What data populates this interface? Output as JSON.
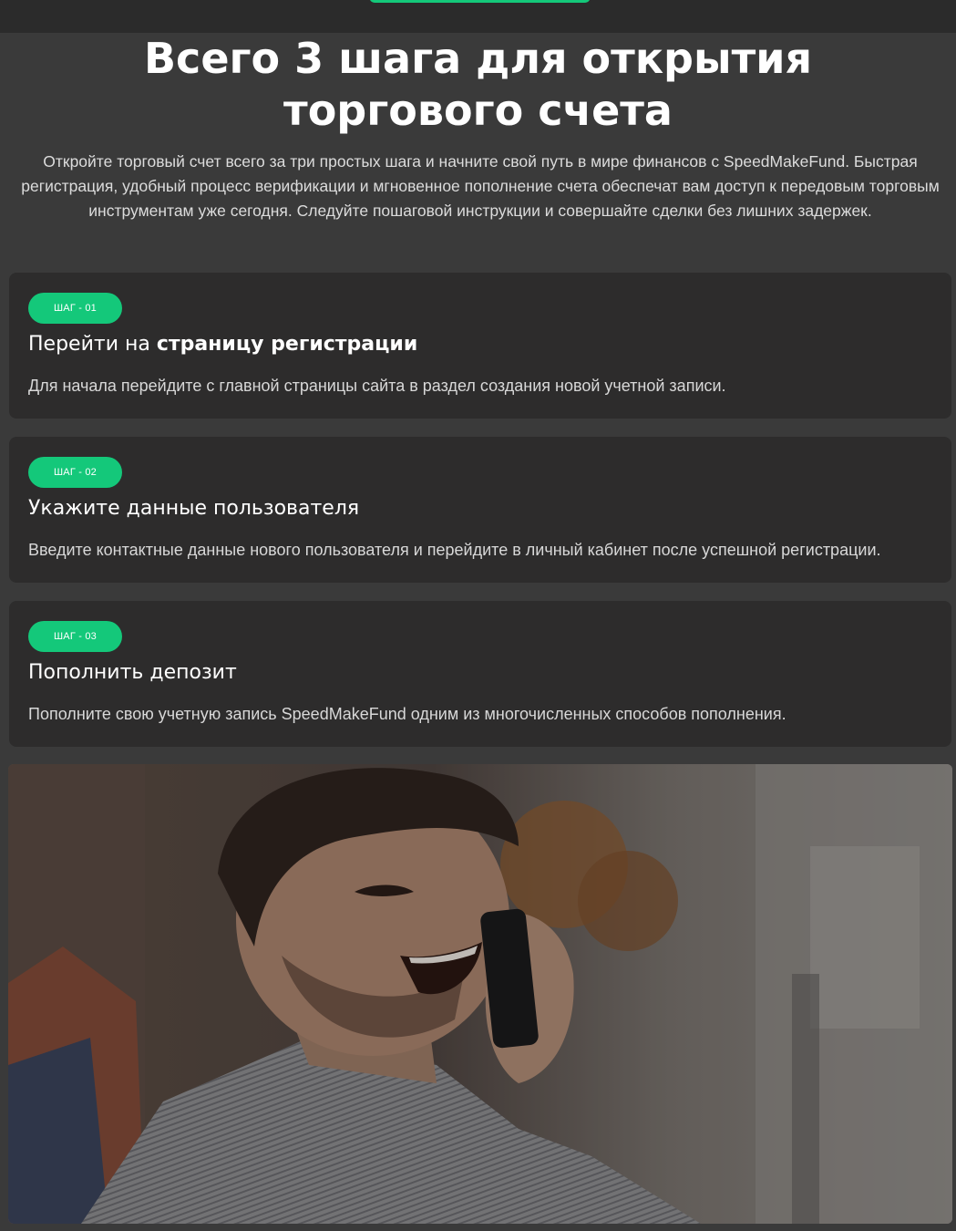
{
  "header": {
    "accent_color": "#14c87a"
  },
  "section": {
    "title_line1": "Всего 3 шага для открытия",
    "title_line2": "торгового счета",
    "intro": "Откройте торговый счет всего за три простых шага и начните свой путь в мире финансов с SpeedMakeFund. Быстрая регистрация, удобный процесс верификации и мгновенное пополнение счета обеспечат вам доступ к передовым торговым инструментам уже сегодня. Следуйте пошаговой инструкции и совершайте сделки без лишних задержек."
  },
  "steps": [
    {
      "badge": "ШАГ - 01",
      "title_regular": "Перейти на ",
      "title_bold": "страницу регистрации",
      "text": "Для начала перейдите с главной страницы сайта в раздел создания новой учетной записи."
    },
    {
      "badge": "ШАГ - 02",
      "title_regular": "Укажите данные пользователя",
      "title_bold": "",
      "text": "Введите контактные данные нового пользователя и перейдите в личный кабинет после успешной регистрации."
    },
    {
      "badge": "ШАГ - 03",
      "title_regular": "Пополнить депозит",
      "title_bold": "",
      "text": "Пополните свою учетную запись SpeedMakeFund одним из многочисленных способов пополнения."
    }
  ],
  "photo": {
    "icon": "man-on-phone-photo"
  }
}
